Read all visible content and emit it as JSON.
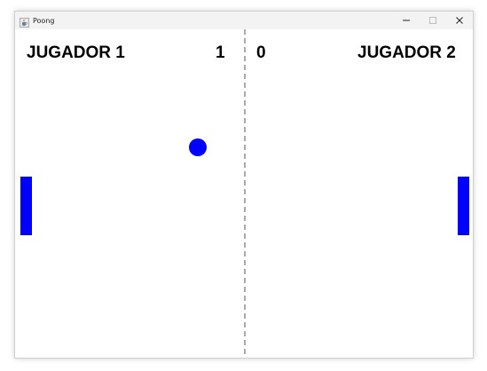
{
  "window": {
    "title": "Poong"
  },
  "scoreboard": {
    "player1_label": "JUGADOR 1",
    "player1_score": "1",
    "player2_score": "0",
    "player2_label": "JUGADOR 2"
  },
  "colors": {
    "game_object": "#0000ff",
    "center_line": "#a9a9a9",
    "text": "#000000"
  },
  "icons": {
    "app": "java-cup-icon",
    "minimize": "minimize-icon",
    "maximize": "maximize-icon",
    "close": "close-icon"
  }
}
